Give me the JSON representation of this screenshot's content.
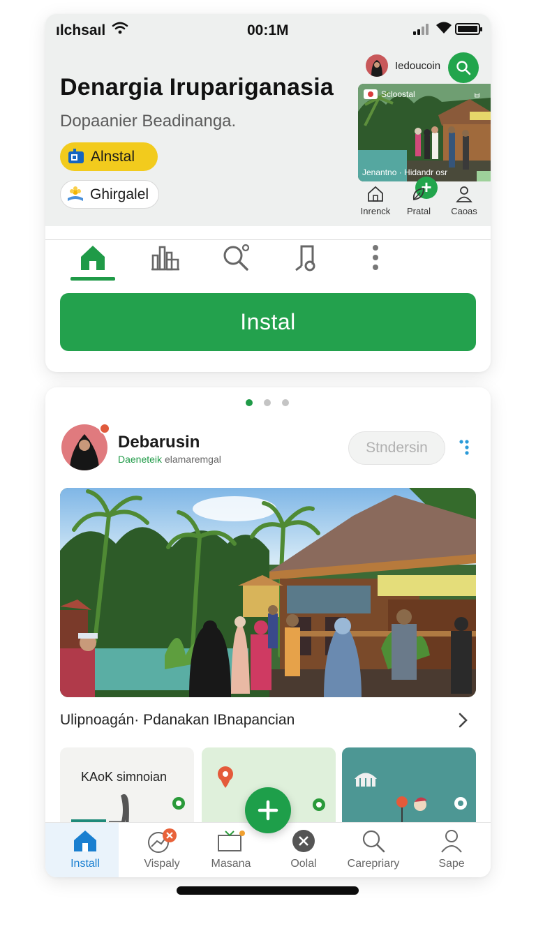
{
  "status_bar": {
    "carrier": "ılchsaıl",
    "time": "00:1M"
  },
  "header": {
    "title": "Denargia Irupariganasia",
    "subtitle": "Dopaanier Beadinanga.",
    "pill_primary": "Alnstal",
    "pill_secondary": "Ghirgalel",
    "user_name": "Iedoucoin"
  },
  "mini_preview": {
    "label_left": "Scloostal",
    "label_right": "ㅂ",
    "caption": "Jenantno · Hidandr osr",
    "nav": [
      {
        "label": "Inrenck",
        "icon": "home-icon"
      },
      {
        "label": "Pratal",
        "icon": "leaf-icon"
      },
      {
        "label": "Caoas",
        "icon": "person-icon"
      }
    ]
  },
  "tabs": [
    {
      "icon": "home-icon",
      "active": true
    },
    {
      "icon": "bar-chart-icon"
    },
    {
      "icon": "search-icon"
    },
    {
      "icon": "music-note-icon"
    },
    {
      "icon": "more-vertical-icon"
    }
  ],
  "install_button": "Instal",
  "carousel": {
    "pages": 3,
    "active": 1
  },
  "post": {
    "author": "Debarusin",
    "sub_green": "Daeneteik",
    "sub_grey": "elamaremgal",
    "subscribe_label": "Stndersin",
    "caption": "Ulipnoagán· Pdanakan IBnapancian"
  },
  "tiles": [
    {
      "label": "KAoK simnoian"
    },
    {
      "label": ""
    },
    {
      "label": ""
    }
  ],
  "bottom_nav": [
    {
      "label": "Install",
      "icon": "home-icon",
      "active": true
    },
    {
      "label": "Vispaly",
      "icon": "chart-icon"
    },
    {
      "label": "Masana",
      "icon": "tv-icon"
    },
    {
      "label": "Oolal",
      "icon": "close-circle-icon"
    },
    {
      "label": "Carepriary",
      "icon": "search-icon"
    },
    {
      "label": "Sape",
      "icon": "person-icon"
    }
  ],
  "colors": {
    "accent_green": "#23a14d",
    "pill_yellow": "#f2cb1d",
    "active_blue": "#1a7fd0",
    "header_bg": "#eef0ef"
  }
}
